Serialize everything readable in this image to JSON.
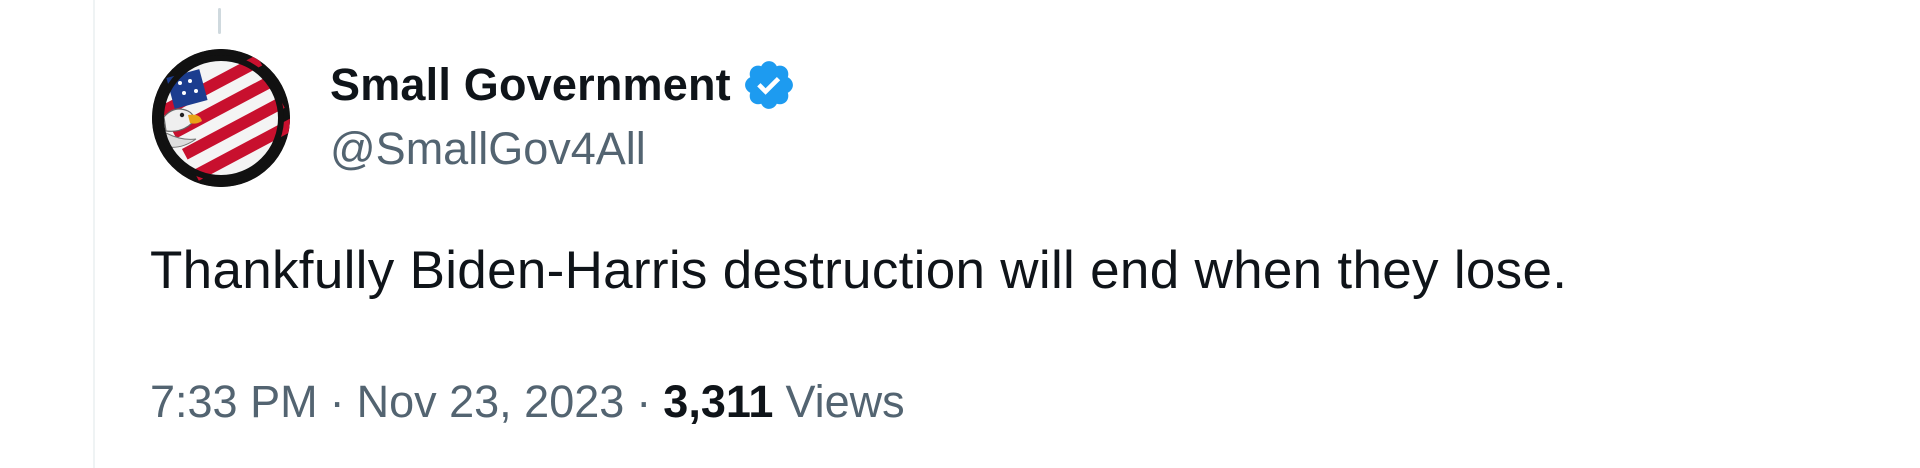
{
  "tweet": {
    "author": {
      "display_name": "Small Government",
      "handle": "@SmallGov4All",
      "verified_icon": "verified-badge-icon",
      "avatar_icon": "eagle-flag-avatar"
    },
    "text": "Thankfully Biden-Harris destruction will end when they lose.",
    "time": "7:33 PM",
    "date": "Nov 23, 2023",
    "separator": "·",
    "views_count": "3,311",
    "views_label": "Views"
  },
  "colors": {
    "text_primary": "#0f1419",
    "text_secondary": "#536471",
    "verified_blue": "#1d9bf0",
    "divider": "#eff3f4"
  }
}
